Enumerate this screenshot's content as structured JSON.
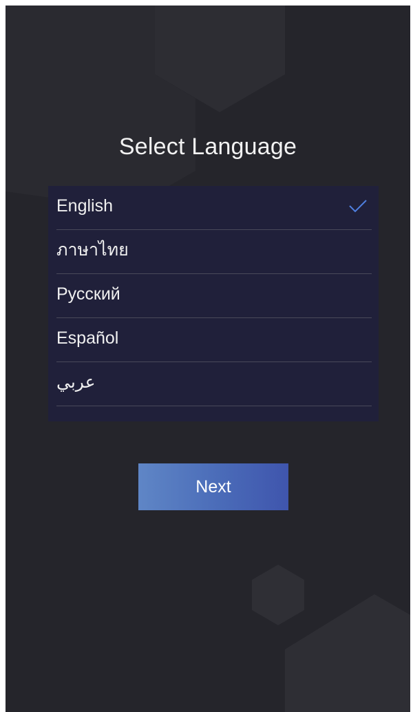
{
  "screen": {
    "title": "Select Language"
  },
  "languages": [
    {
      "label": "English",
      "selected": true
    },
    {
      "label": "ภาษาไทย",
      "selected": false
    },
    {
      "label": "Русский",
      "selected": false
    },
    {
      "label": "Español",
      "selected": false
    },
    {
      "label": "عربي",
      "selected": false
    }
  ],
  "actions": {
    "next_label": "Next"
  },
  "icons": {
    "selected_indicator": "check-icon"
  },
  "colors": {
    "background": "#25252b",
    "list_background": "#20203a",
    "accent": "#4a6bb8",
    "check": "#4f7fe0"
  }
}
